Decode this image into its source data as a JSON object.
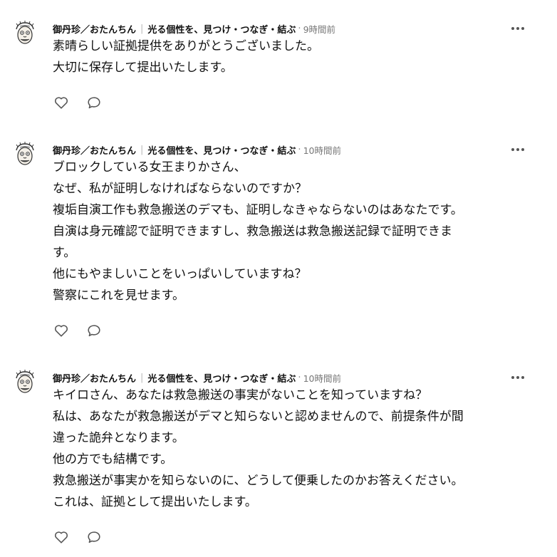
{
  "posts": [
    {
      "author": {
        "name": "御丹珍／おたんちん",
        "tagline": "光る個性を、見つけ・つなぎ・結ぶ",
        "avatar_icon": "cartoon-face-avatar-icon"
      },
      "separator": "|",
      "timestamp": "9時間前",
      "body_lines": [
        "素晴らしい証拠提供をありがとうございました。",
        "大切に保存して提出いたします。"
      ]
    },
    {
      "author": {
        "name": "御丹珍／おたんちん",
        "tagline": "光る個性を、見つけ・つなぎ・結ぶ",
        "avatar_icon": "cartoon-face-avatar-icon"
      },
      "separator": "|",
      "timestamp": "10時間前",
      "body_lines": [
        "ブロックしている女王まりかさん、",
        "なぜ、私が証明しなければならないのですか？",
        "複垢自演工作も救急搬送のデマも、証明しなきゃならないのはあなたです。",
        "自演は身元確認で証明できますし、救急搬送は救急搬送記録で証明できま",
        "す。",
        "他にもやましいことをいっぱいしていますね？",
        "警察にこれを見せます。"
      ]
    },
    {
      "author": {
        "name": "御丹珍／おたんちん",
        "tagline": "光る個性を、見つけ・つなぎ・結ぶ",
        "avatar_icon": "cartoon-face-avatar-icon"
      },
      "separator": "|",
      "timestamp": "10時間前",
      "body_lines": [
        "キイロさん、あなたは救急搬送の事実がないことを知っていますね？",
        "私は、あなたが救急搬送がデマと知らないと認めませんので、前提条件が間",
        "違った詭弁となります。",
        "他の方でも結構です。",
        "救急搬送が事実かを知らないのに、どうして便乗したのかお答えください。",
        "これは、証拠として提出いたします。"
      ]
    }
  ],
  "icons": {
    "more": "more-options-icon",
    "like": "heart-icon",
    "reply": "comment-icon"
  },
  "colors": {
    "text": "#111111",
    "timestamp": "#777777",
    "icon": "#555555"
  }
}
